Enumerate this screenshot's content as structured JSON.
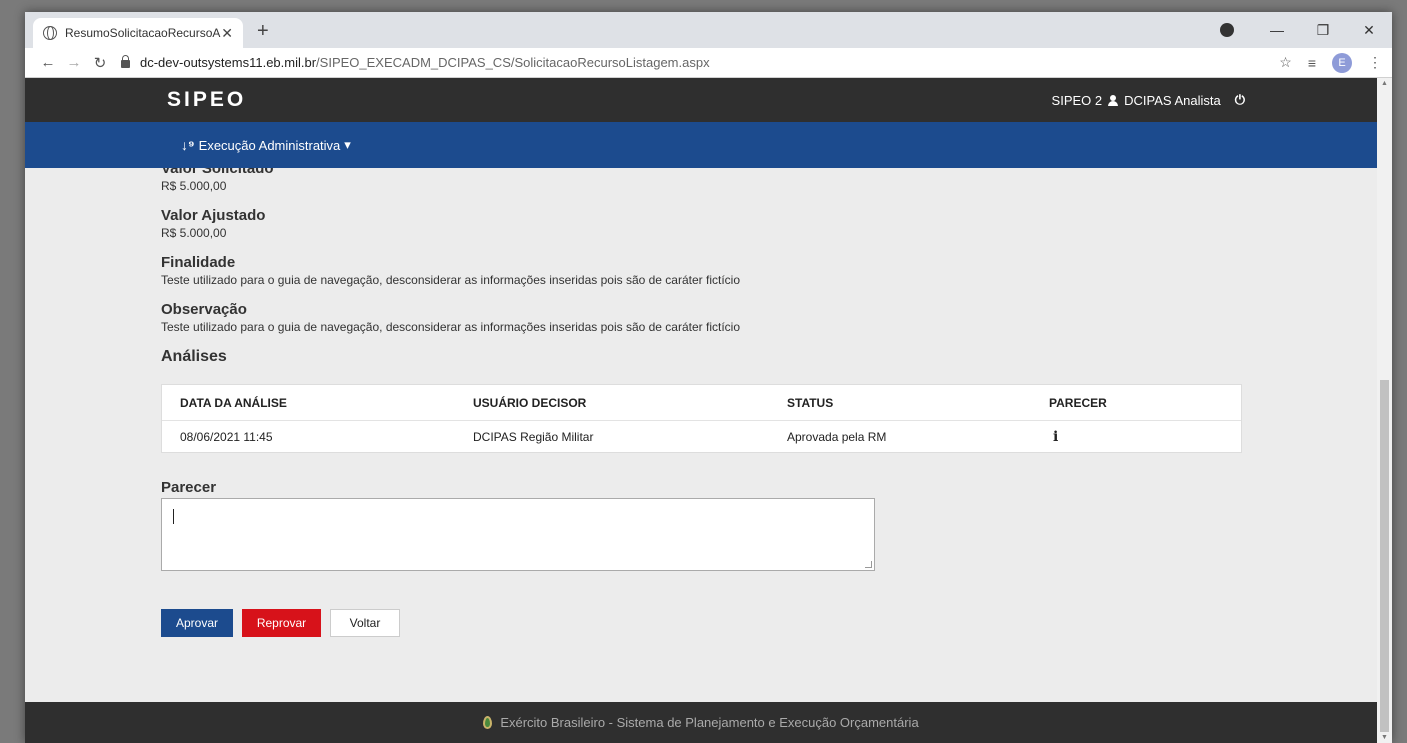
{
  "browser": {
    "tab_title": "ResumoSolicitacaoRecursoAS",
    "url_domain": "dc-dev-outsystems11.eb.mil.br",
    "url_path": "/SIPEO_EXECADM_DCIPAS_CS/SolicitacaoRecursoListagem.aspx",
    "profile_initial": "E"
  },
  "header": {
    "logo": "SIPEO",
    "app_version": "SIPEO 2",
    "user_name": "DCIPAS Analista"
  },
  "nav": {
    "menu_label": "Execução Administrativa",
    "menu_caret": "▾"
  },
  "fields": [
    {
      "label": "Valor Solicitado",
      "value": "R$ 5.000,00"
    },
    {
      "label": "Valor Ajustado",
      "value": "R$ 5.000,00"
    },
    {
      "label": "Finalidade",
      "value": "Teste utilizado para o guia de navegação, desconsiderar as informações inseridas pois são de caráter fictício"
    },
    {
      "label": "Observação",
      "value": "Teste utilizado para o guia de navegação, desconsiderar as informações inseridas pois são de caráter fictício"
    }
  ],
  "analises": {
    "title": "Análises",
    "columns": [
      "DATA DA ANÁLISE",
      "USUÁRIO DECISOR",
      "STATUS",
      "PARECER"
    ],
    "rows": [
      {
        "data": "08/06/2021 11:45",
        "usuario": "DCIPAS Região Militar",
        "status": "Aprovada pela RM",
        "parecer_icon": "i"
      }
    ]
  },
  "parecer": {
    "label": "Parecer",
    "value": ""
  },
  "buttons": {
    "approve": "Aprovar",
    "reject": "Reprovar",
    "back": "Voltar"
  },
  "footer": {
    "text": "Exército Brasileiro - Sistema de Planejamento e Execução Orçamentária"
  },
  "colors": {
    "header_bg": "#2f2f2f",
    "nav_bg": "#1c4b8e",
    "approve_bg": "#1c4b8e",
    "reject_bg": "#d7121a"
  }
}
